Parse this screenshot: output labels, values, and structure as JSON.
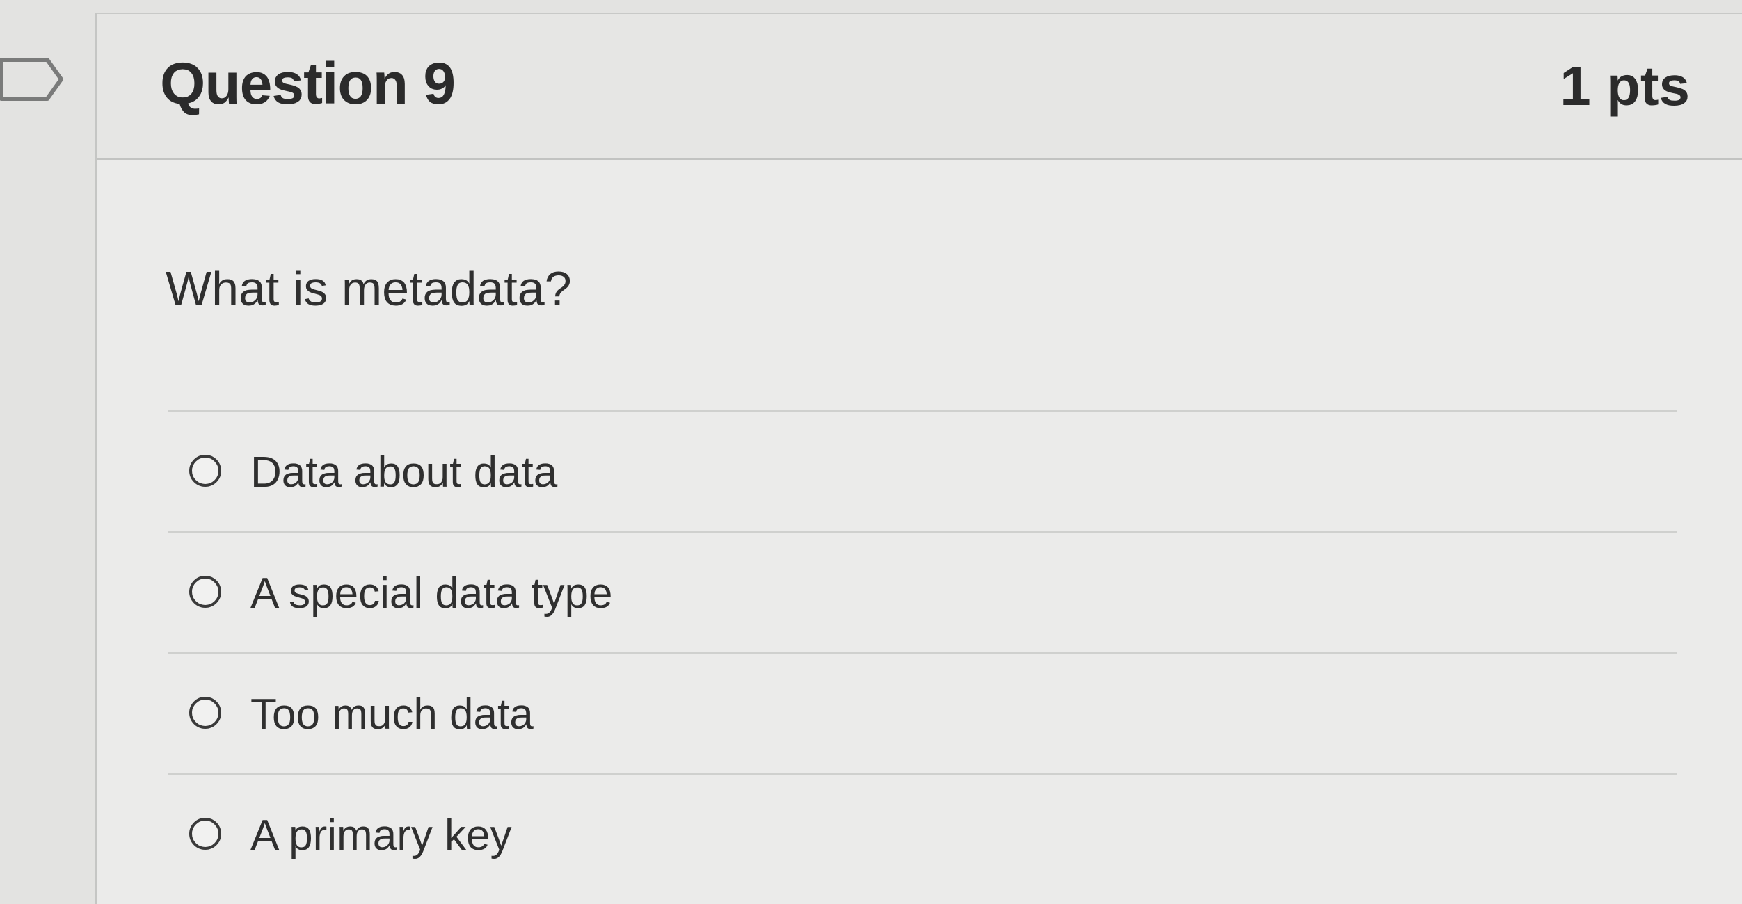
{
  "question": {
    "title": "Question 9",
    "points": "1 pts",
    "text": "What is metadata?"
  },
  "answers": [
    {
      "label": "Data about data"
    },
    {
      "label": "A special data type"
    },
    {
      "label": "Too much data"
    },
    {
      "label": "A primary key"
    }
  ],
  "icons": {
    "flag": "flag-outline-icon"
  }
}
